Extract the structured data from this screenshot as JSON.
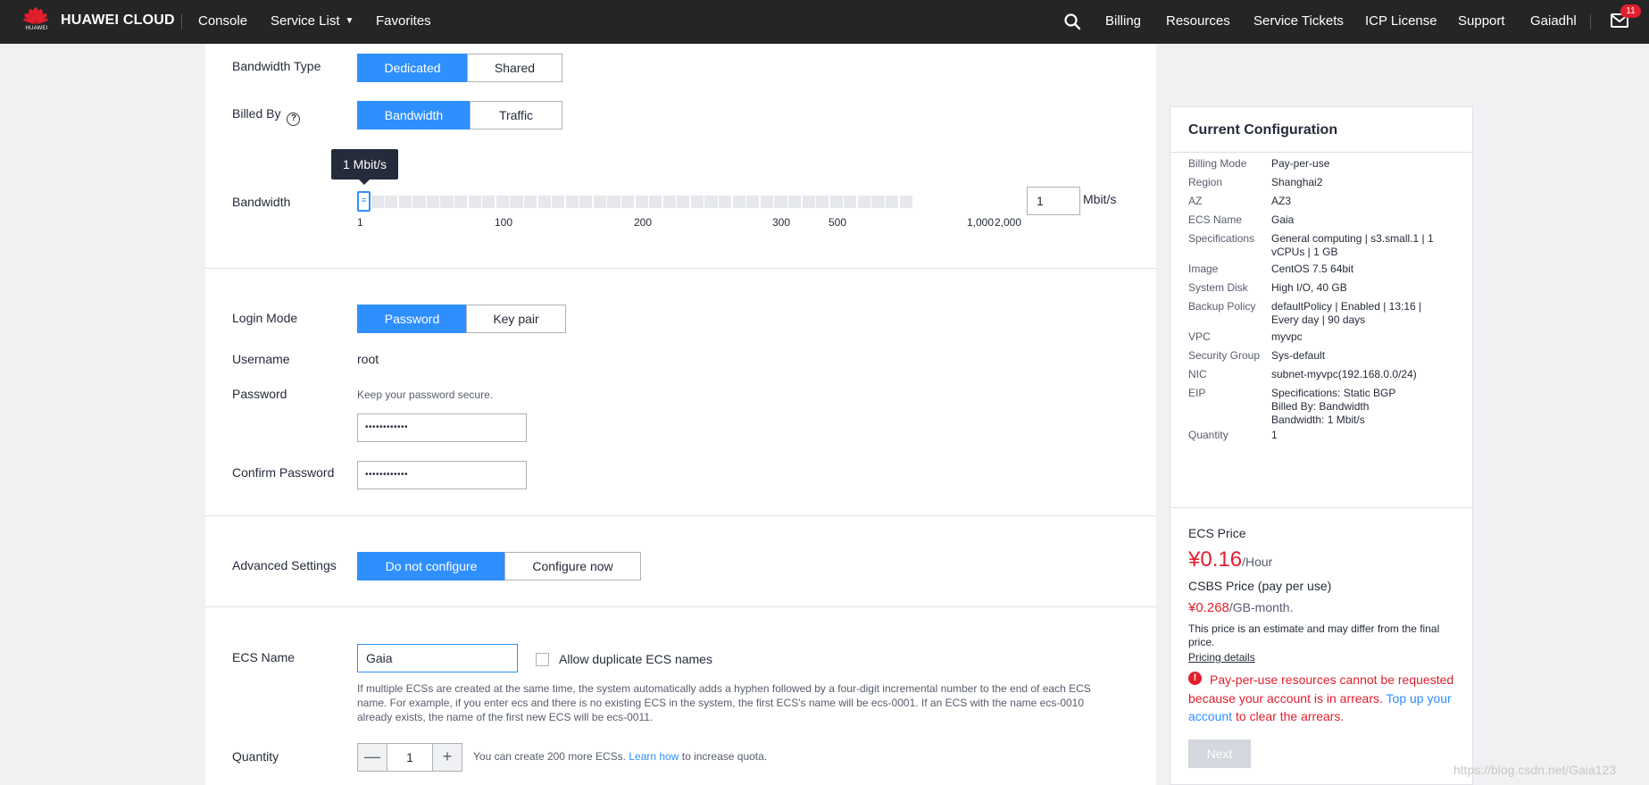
{
  "topnav": {
    "logo_text": "HUAWEI",
    "brand": "HUAWEI CLOUD",
    "console": "Console",
    "service_list": "Service List",
    "favorites": "Favorites",
    "billing": "Billing",
    "resources": "Resources",
    "service_tickets": "Service Tickets",
    "icp_license": "ICP License",
    "support": "Support",
    "user": "Gaiadhl",
    "mail_count": "11"
  },
  "bandwidth_type": {
    "label": "Bandwidth Type",
    "options": [
      "Dedicated",
      "Shared"
    ],
    "selected": "Dedicated"
  },
  "billed_by": {
    "label": "Billed By",
    "help_icon": "?",
    "options": [
      "Bandwidth",
      "Traffic"
    ],
    "selected": "Bandwidth"
  },
  "bandwidth": {
    "label": "Bandwidth",
    "tooltip": "1 Mbit/s",
    "ticks": [
      "1",
      "100",
      "200",
      "300",
      "500",
      "1,000",
      "2,000"
    ],
    "value": "1",
    "unit": "Mbit/s"
  },
  "login_mode": {
    "label": "Login Mode",
    "options": [
      "Password",
      "Key pair"
    ],
    "selected": "Password"
  },
  "username": {
    "label": "Username",
    "value": "root"
  },
  "password": {
    "label": "Password",
    "hint": "Keep your password secure.",
    "value": "••••••••••••"
  },
  "confirm_password": {
    "label": "Confirm Password",
    "value": "••••••••••••"
  },
  "advanced_settings": {
    "label": "Advanced Settings",
    "options": [
      "Do not configure",
      "Configure now"
    ],
    "selected": "Do not configure"
  },
  "ecs_name": {
    "label": "ECS Name",
    "value": "Gaia",
    "allow_duplicate_label": "Allow duplicate ECS names",
    "description": "If multiple ECSs are created at the same time, the system automatically adds a hyphen followed by a four-digit incremental number to the end of each ECS name. For example, if you enter ecs and there is no existing ECS in the system, the first ECS's name will be ecs-0001. If an ECS with the name ecs-0010 already exists, the name of the first new ECS will be ecs-0011."
  },
  "quantity": {
    "label": "Quantity",
    "minus": "—",
    "value": "1",
    "plus": "+",
    "quota_text": "You can create 200 more ECSs.",
    "learn_how": "Learn how",
    "quota_suffix": "to increase quota."
  },
  "current_config": {
    "title": "Current Configuration",
    "rows": [
      {
        "key": "Billing Mode",
        "value": "Pay-per-use"
      },
      {
        "key": "Region",
        "value": "Shanghai2"
      },
      {
        "key": "AZ",
        "value": "AZ3"
      },
      {
        "key": "ECS Name",
        "value": "Gaia"
      },
      {
        "key": "Specifications",
        "value": "General computing | s3.small.1 | 1 vCPUs | 1 GB"
      },
      {
        "key": "Image",
        "value": "CentOS 7.5 64bit"
      },
      {
        "key": "System Disk",
        "value": "High I/O, 40 GB"
      },
      {
        "key": "Backup Policy",
        "value": "defaultPolicy | Enabled | 13:16 | Every day | 90 days"
      },
      {
        "key": "VPC",
        "value": "myvpc"
      },
      {
        "key": "Security Group",
        "value": "Sys-default"
      },
      {
        "key": "NIC",
        "value": "subnet-myvpc(192.168.0.0/24)"
      },
      {
        "key": "EIP",
        "value": "Specifications: Static BGP\nBilled By: Bandwidth\nBandwidth: 1 Mbit/s"
      },
      {
        "key": "Quantity",
        "value": "1"
      }
    ],
    "ecs_price_label": "ECS Price",
    "ecs_price": "¥0.16",
    "ecs_price_unit": "/Hour",
    "csbs_price_label": "CSBS Price (pay per use)",
    "csbs_price": "¥0.268",
    "csbs_price_unit": "/GB-month.",
    "estimate_note": "This price is an estimate and may differ from the final price.",
    "pricing_details": "Pricing details",
    "warning_icon": "!",
    "warning_text": "Pay-per-use resources cannot be requested because your account is in arrears.",
    "top_up_link": "Top up your account",
    "warning_suffix": "to clear the arrears.",
    "next": "Next"
  },
  "watermark": "https://blog.csdn.net/Gaia123",
  "colors": {
    "accent": "#2e8fff",
    "error": "#e31e2d",
    "nav_bg": "#252525"
  }
}
